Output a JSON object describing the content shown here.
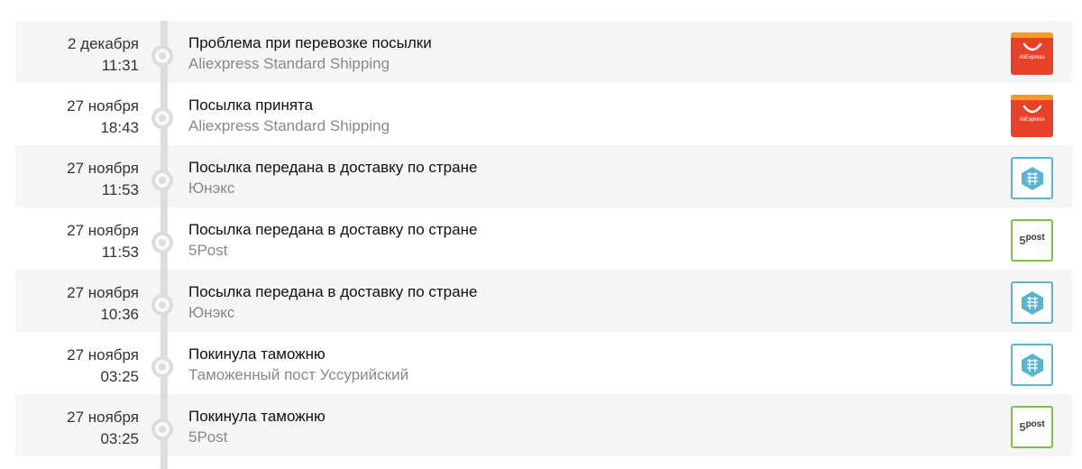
{
  "events": [
    {
      "date": "2 декабря",
      "time": "11:31",
      "title": "Проблема при перевозке посылки",
      "source": "Aliexpress Standard Shipping",
      "logo": "aliexpress"
    },
    {
      "date": "27 ноября",
      "time": "18:43",
      "title": "Посылка принята",
      "source": "Aliexpress Standard Shipping",
      "logo": "aliexpress"
    },
    {
      "date": "27 ноября",
      "time": "11:53",
      "title": "Посылка передана в доставку по стране",
      "source": "Юнэкс",
      "logo": "unex"
    },
    {
      "date": "27 ноября",
      "time": "11:53",
      "title": "Посылка передана в доставку по стране",
      "source": "5Post",
      "logo": "5post"
    },
    {
      "date": "27 ноября",
      "time": "10:36",
      "title": "Посылка передана в доставку по стране",
      "source": "Юнэкс",
      "logo": "unex"
    },
    {
      "date": "27 ноября",
      "time": "03:25",
      "title": "Покинула таможню",
      "source": "Таможенный пост Уссурийский",
      "logo": "unex"
    },
    {
      "date": "27 ноября",
      "time": "03:25",
      "title": "Покинула таможню",
      "source": "5Post",
      "logo": "5post"
    }
  ],
  "logo_text": {
    "aliexpress": "AliExpress",
    "fivepost_num": "5",
    "fivepost_word": "post"
  },
  "colors": {
    "row_bg": "#f5f5f5",
    "alt_bg": "#ffffff",
    "timeline": "#dcdcdc",
    "aliexpress": "#e8412a",
    "unex": "#5ab4d0",
    "fivepost": "#7cc04b"
  }
}
